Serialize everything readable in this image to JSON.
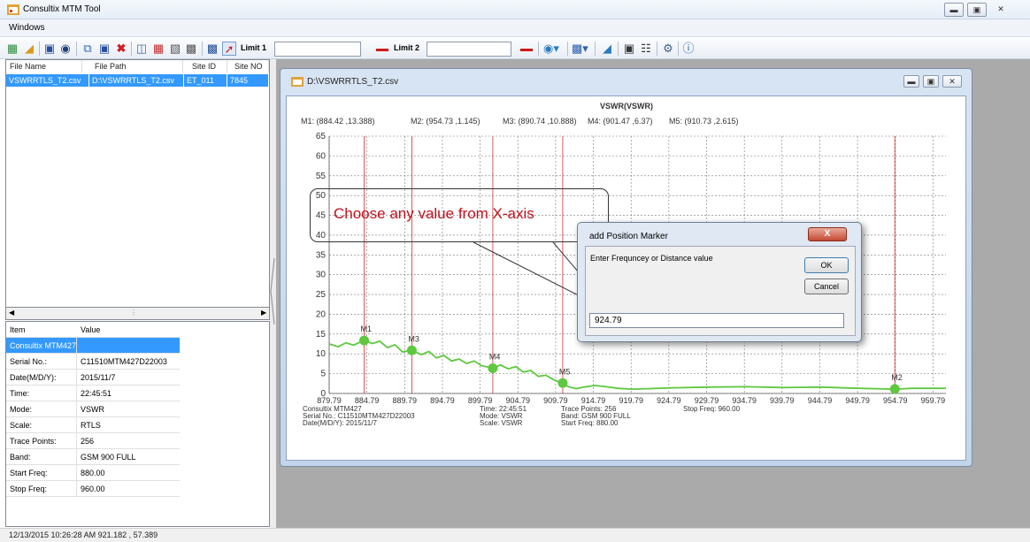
{
  "app": {
    "title": "Consultix MTM Tool"
  },
  "menu": {
    "windows": "Windows"
  },
  "toolbar": {
    "limit1_label": "Limit 1",
    "limit1_value": "",
    "limit2_label": "Limit 2",
    "limit2_value": ""
  },
  "file_grid": {
    "headers": [
      "File Name",
      "File Path",
      "Site ID",
      "Site NO"
    ],
    "rows": [
      [
        "VSWRRTLS_T2.csv",
        "D:\\VSWRRTLS_T2.csv",
        "ET_011",
        "7845"
      ]
    ]
  },
  "props": {
    "headers": [
      "Item",
      "Value"
    ],
    "rows": [
      [
        "Consultix MTM427",
        ""
      ],
      [
        "Serial No.:",
        "C11510MTM427D22003"
      ],
      [
        "Date(M/D/Y):",
        "2015/11/7"
      ],
      [
        "Time:",
        "22:45:51"
      ],
      [
        "Mode:",
        "VSWR"
      ],
      [
        "Scale:",
        "RTLS"
      ],
      [
        "Trace Points:",
        "256"
      ],
      [
        "Band:",
        "GSM 900 FULL"
      ],
      [
        "Start Freq:",
        "880.00"
      ],
      [
        "Stop Freq:",
        "960.00"
      ]
    ]
  },
  "status": {
    "text": "12/13/2015 10:26:28 AM  921.182 , 57.389"
  },
  "child_window": {
    "title": "D:\\VSWRRTLS_T2.csv"
  },
  "chart_data": {
    "type": "line",
    "title": "VSWR(VSWR)",
    "marker_readouts": [
      "M1: (884.42 ,13.388)",
      "M2: (954.73 ,1.145)",
      "M3: (890.74 ,10.888)",
      "M4: (901.47 ,6.37)",
      "M5: (910.73 ,2.615)"
    ],
    "xlim": [
      879.79,
      961.5
    ],
    "ylim": [
      0,
      65
    ],
    "x_ticks": [
      "879.79",
      "884.79",
      "889.79",
      "894.79",
      "899.79",
      "904.79",
      "909.79",
      "914.79",
      "919.79",
      "924.79",
      "929.79",
      "934.79",
      "939.79",
      "944.79",
      "949.79",
      "954.79",
      "959.79"
    ],
    "y_ticks": [
      "0",
      "5",
      "10",
      "15",
      "20",
      "25",
      "30",
      "35",
      "40",
      "45",
      "50",
      "55",
      "60",
      "65"
    ],
    "grid": true,
    "series": [
      {
        "color": "#5ec83f",
        "x": [
          879.8,
          881.0,
          882.0,
          883.0,
          884.4,
          885.5,
          886.5,
          887.5,
          888.5,
          889.5,
          890.7,
          892.0,
          893.0,
          894.0,
          895.0,
          896.0,
          897.0,
          898.0,
          899.0,
          900.0,
          901.5,
          902.5,
          903.5,
          904.5,
          905.5,
          906.5,
          907.5,
          908.5,
          909.5,
          910.7,
          911.5,
          912.5,
          913.5,
          915.0,
          916.5,
          918.0,
          920.0,
          922.0,
          925.0,
          930.0,
          935.0,
          940.0,
          945.0,
          950.0,
          954.7,
          957.0,
          961.5
        ],
        "y": [
          12.5,
          11.8,
          12.8,
          12.2,
          13.4,
          12.6,
          13.2,
          11.6,
          12.3,
          10.5,
          10.9,
          9.8,
          10.6,
          9.0,
          9.6,
          8.2,
          8.7,
          7.6,
          8.2,
          7.0,
          6.4,
          7.2,
          6.2,
          6.8,
          5.4,
          5.8,
          4.3,
          4.6,
          3.5,
          2.6,
          1.7,
          1.2,
          1.6,
          2.0,
          1.7,
          1.3,
          1.1,
          1.2,
          1.4,
          1.6,
          1.7,
          1.5,
          1.6,
          1.3,
          1.1,
          1.3,
          1.3
        ]
      }
    ],
    "markers": [
      {
        "label": "M1",
        "x": 884.42,
        "y": 13.388
      },
      {
        "label": "M3",
        "x": 890.74,
        "y": 10.888
      },
      {
        "label": "M4",
        "x": 901.47,
        "y": 6.37
      },
      {
        "label": "M5",
        "x": 910.73,
        "y": 2.615
      },
      {
        "label": "M2",
        "x": 954.73,
        "y": 1.145
      }
    ],
    "footer": {
      "col1": [
        "Consultix MTM427",
        "Serial No.: C11510MTM427D22003",
        "Date(M/D/Y): 2015/11/7"
      ],
      "col2": [
        "Time: 22:45:51",
        "Mode: VSWR",
        "Scale: VSWR"
      ],
      "col3": [
        "Trace Points: 256",
        "Band: GSM 900 FULL",
        "Start Freq: 880.00"
      ],
      "col4": [
        "Stop Freq: 960.00"
      ]
    }
  },
  "callout": {
    "text": "Choose any value from X-axis"
  },
  "dialog": {
    "title": "add Position Marker",
    "close": "X",
    "prompt": "Enter Frequncey or Distance value",
    "ok": "OK",
    "cancel": "Cancel",
    "input_value": "924.79"
  },
  "colors": {
    "selection": "#3399ff",
    "trace": "#5ec83f",
    "marker_line": "#cc3333",
    "callout_text": "#c0101e"
  }
}
